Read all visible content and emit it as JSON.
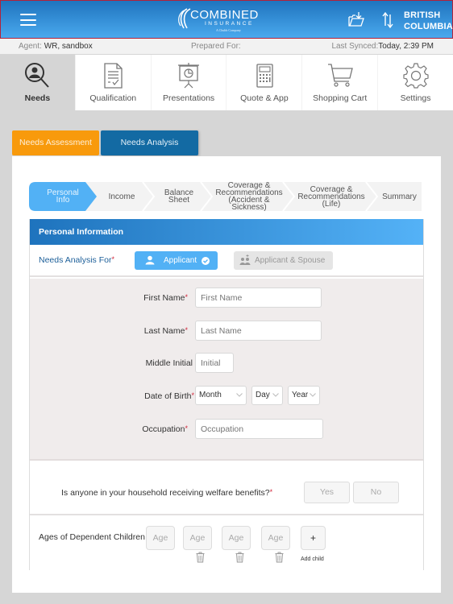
{
  "header": {
    "menu_icon": "hamburger-icon",
    "logo": {
      "brand": "COMBINED",
      "sub": "INSURANCE",
      "tagline": "A Chubb Company"
    },
    "folder_icon": "folder-download-icon",
    "sync_icon": "up-down-arrows-icon",
    "region_line1": "BRITISH",
    "region_line2": "COLUMBIA"
  },
  "infobar": {
    "agent_label": "Agent: ",
    "agent_value": "WR, sandbox",
    "prepared_label": "Prepared For:",
    "synced_label": "Last Synced:",
    "synced_value": "Today, 2:39 PM"
  },
  "nav": [
    {
      "label": "Needs",
      "icon": "person-search-icon",
      "active": true
    },
    {
      "label": "Qualification",
      "icon": "document-check-icon"
    },
    {
      "label": "Presentations",
      "icon": "presentation-board-icon"
    },
    {
      "label": "Quote & App",
      "icon": "calculator-icon"
    },
    {
      "label": "Shopping Cart",
      "icon": "shopping-cart-icon"
    },
    {
      "label": "Settings",
      "icon": "gear-icon"
    }
  ],
  "subtabs": {
    "assessment": "Needs Assessment",
    "analysis": "Needs Analysis"
  },
  "steps": [
    {
      "line1": "Personal",
      "line2": "Info",
      "active": true
    },
    {
      "line1": "Income"
    },
    {
      "line1": "Balance",
      "line2": "Sheet"
    },
    {
      "line1": "Coverage &",
      "line2": "Recommendations",
      "line3": "(Accident &",
      "line4": "Sickness)"
    },
    {
      "line1": "Coverage &",
      "line2": "Recommendations",
      "line3": "(Life)"
    },
    {
      "line1": "Summary"
    }
  ],
  "panel": {
    "title": "Personal Information",
    "analysis_for_label": "Needs Analysis For",
    "required_mark": "*",
    "applicant_btn": "Applicant",
    "spouse_btn": "Applicant & Spouse",
    "fields": {
      "first_name": {
        "label": "First Name",
        "placeholder": "First Name",
        "value": ""
      },
      "last_name": {
        "label": "Last Name",
        "placeholder": "Last Name",
        "value": ""
      },
      "middle_initial": {
        "label": "Middle Initial",
        "placeholder": "Initial",
        "value": ""
      },
      "dob": {
        "label": "Date of Birth",
        "month": "Month",
        "day": "Day",
        "year": "Year"
      },
      "occupation": {
        "label": "Occupation",
        "placeholder": "Occupation",
        "value": ""
      }
    },
    "welfare": {
      "question": "Is anyone in your household receiving welfare benefits?",
      "yes": "Yes",
      "no": "No"
    },
    "children": {
      "label": "Ages of Dependent Children",
      "age_placeholder": "Age",
      "add_label": "+",
      "add_caption": "Add child"
    }
  },
  "colors": {
    "header_top": "#1f74be",
    "header_bottom": "#4aa9ee",
    "assessment_tab": "#f89a0c",
    "analysis_tab": "#136aa3",
    "step_active": "#52b1f5",
    "required": "#d0263a"
  }
}
